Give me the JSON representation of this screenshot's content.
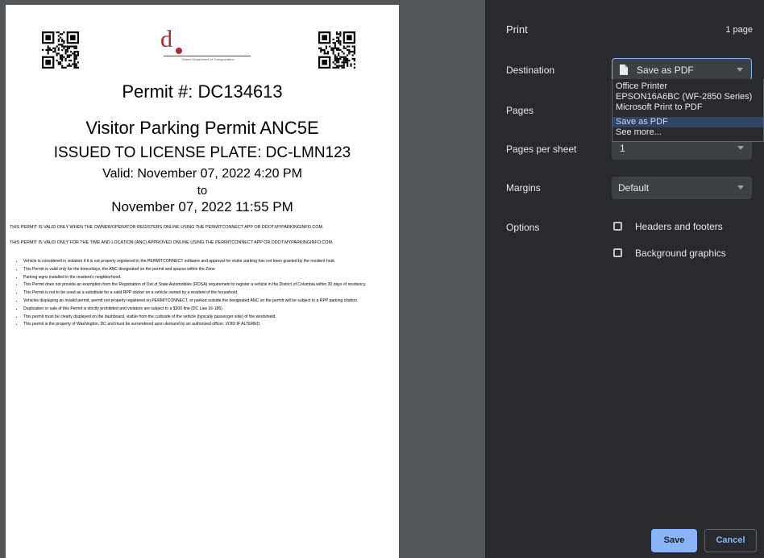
{
  "document": {
    "logo_caption": "District Department of Transportation",
    "permit_number": "Permit #: DC134613",
    "permit_title": "Visitor Parking Permit ANC5E",
    "issued_to": "ISSUED TO LICENSE PLATE: DC-LMN123",
    "valid_from": "Valid: November 07, 2022 4:20 PM",
    "valid_to_word": "to",
    "valid_until": "November 07, 2022 11:55 PM",
    "notice_1": "THIS PERMIT IS VALID ONLY WHEN THE OWNER/OPERATOR REGISTERS ONLINE USING THE PERMITCONNECT APP OR DDOT.MYPARKINGINFO.COM.",
    "notice_2": "THIS PERMIT IS VALID ONLY FOR THE TIME AND LOCATION (ANC) APPROVED ONLINE USING THE PERMITCONNECT APP OR DDOT.MYPARKINGINFO.COM.",
    "rules": [
      "Vehicle is considered in violation if it is not properly registered in the PERMITCONNECT software and approval for visitor parking has not been granted by the resident host.",
      "This Permit is valid only for the times/days, the ANC designated on the permit and spaces within the Zone",
      "Parking signs installed in the resident's neighborhood.",
      "This Permit does not provide an exemption from the Registration of Out of State Automobiles (ROSA) requirement to register a vehicle in the District of Columbia within 30 days of residency.",
      "This Permit is not to be used as a substitute for a valid RPP sticker on a vehicle owned by a resident of the household.",
      "Vehicles displaying an invalid permit, permit not properly registered on PERMITCONNECT, or parked outside the designated ANC on the permit will be subject to a RPP parking citation.",
      "Duplication or sale of this Permit is strictly prohibited and violators are subject to a $300 fine (DC Law 16-186)",
      "This permit must be clearly displayed on the dashboard, visible from the curbside of the vehicle (typically passenger side) of the windshield.",
      "This permit is the property of Washington, DC and must be surrendered upon demand by an authorized officer. VOID IF ALTERED."
    ]
  },
  "panel": {
    "title": "Print",
    "page_count": "1 page",
    "destination_label": "Destination",
    "destination_value": "Save as PDF",
    "destination_options": [
      "Office Printer",
      "EPSON16A6BC (WF-2850 Series)",
      "Microsoft Print to PDF",
      "Save as PDF",
      "See more..."
    ],
    "pages_label": "Pages",
    "pages_per_sheet_label": "Pages per sheet",
    "pages_per_sheet_value": "1",
    "margins_label": "Margins",
    "margins_value": "Default",
    "options_label": "Options",
    "headers_footers_label": "Headers and footers",
    "background_graphics_label": "Background graphics",
    "save_label": "Save",
    "cancel_label": "Cancel"
  },
  "colors": {
    "accent": "#8ab4f8",
    "panel_bg": "#292a2d",
    "logo_red": "#b5282d"
  }
}
